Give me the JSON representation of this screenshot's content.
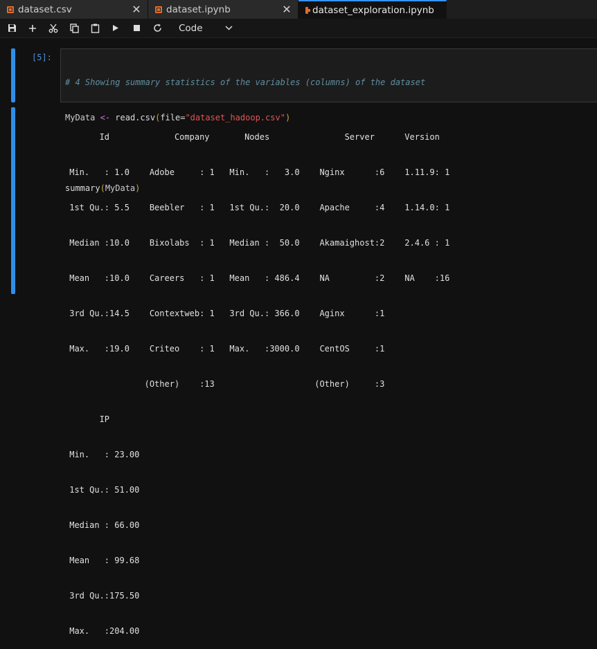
{
  "tabs": [
    {
      "label": "dataset.csv",
      "active": false,
      "closable": true
    },
    {
      "label": "dataset.ipynb",
      "active": false,
      "closable": true
    },
    {
      "label": "dataset_exploration.ipynb",
      "active": true,
      "dirty": true
    }
  ],
  "toolbar": {
    "cell_type": "Code",
    "buttons": [
      "save-icon",
      "plus-icon",
      "scissors-icon",
      "copy-icon",
      "paste-icon",
      "play-icon",
      "stop-icon",
      "restart-icon"
    ]
  },
  "cell": {
    "prompt": "[5]:",
    "code": {
      "comment": "# 4 Showing summary statistics of the variables (columns) of the dataset",
      "line2_var": "MyData",
      "line2_op": "<-",
      "line2_fn": "read.csv",
      "line2_arg": "file=",
      "line2_str": "\"dataset_hadoop.csv\"",
      "line3": "",
      "line4_fn": "summary",
      "line4_arg": "MyData"
    },
    "output_lines": [
      "       Id             Company       Nodes               Server      Version  ",
      " Min.   : 1.0    Adobe     : 1   Min.   :   3.0    Nginx      :6    1.11.9: 1  ",
      " 1st Qu.: 5.5    Beebler   : 1   1st Qu.:  20.0    Apache     :4    1.14.0: 1  ",
      " Median :10.0    Bixolabs  : 1   Median :  50.0    Akamaighost:2    2.4.6 : 1  ",
      " Mean   :10.0    Careers   : 1   Mean   : 486.4    NA         :2    NA    :16  ",
      " 3rd Qu.:14.5    Contextweb: 1   3rd Qu.: 366.0    Aginx      :1               ",
      " Max.   :19.0    Criteo    : 1   Max.   :3000.0    CentOS     :1               ",
      "                (Other)    :13                    (Other)     :3               ",
      "       IP        ",
      " Min.   : 23.00  ",
      " 1st Qu.: 51.00  ",
      " Median : 66.00  ",
      " Mean   : 99.68  ",
      " 3rd Qu.:175.50  ",
      " Max.   :204.00  "
    ]
  }
}
